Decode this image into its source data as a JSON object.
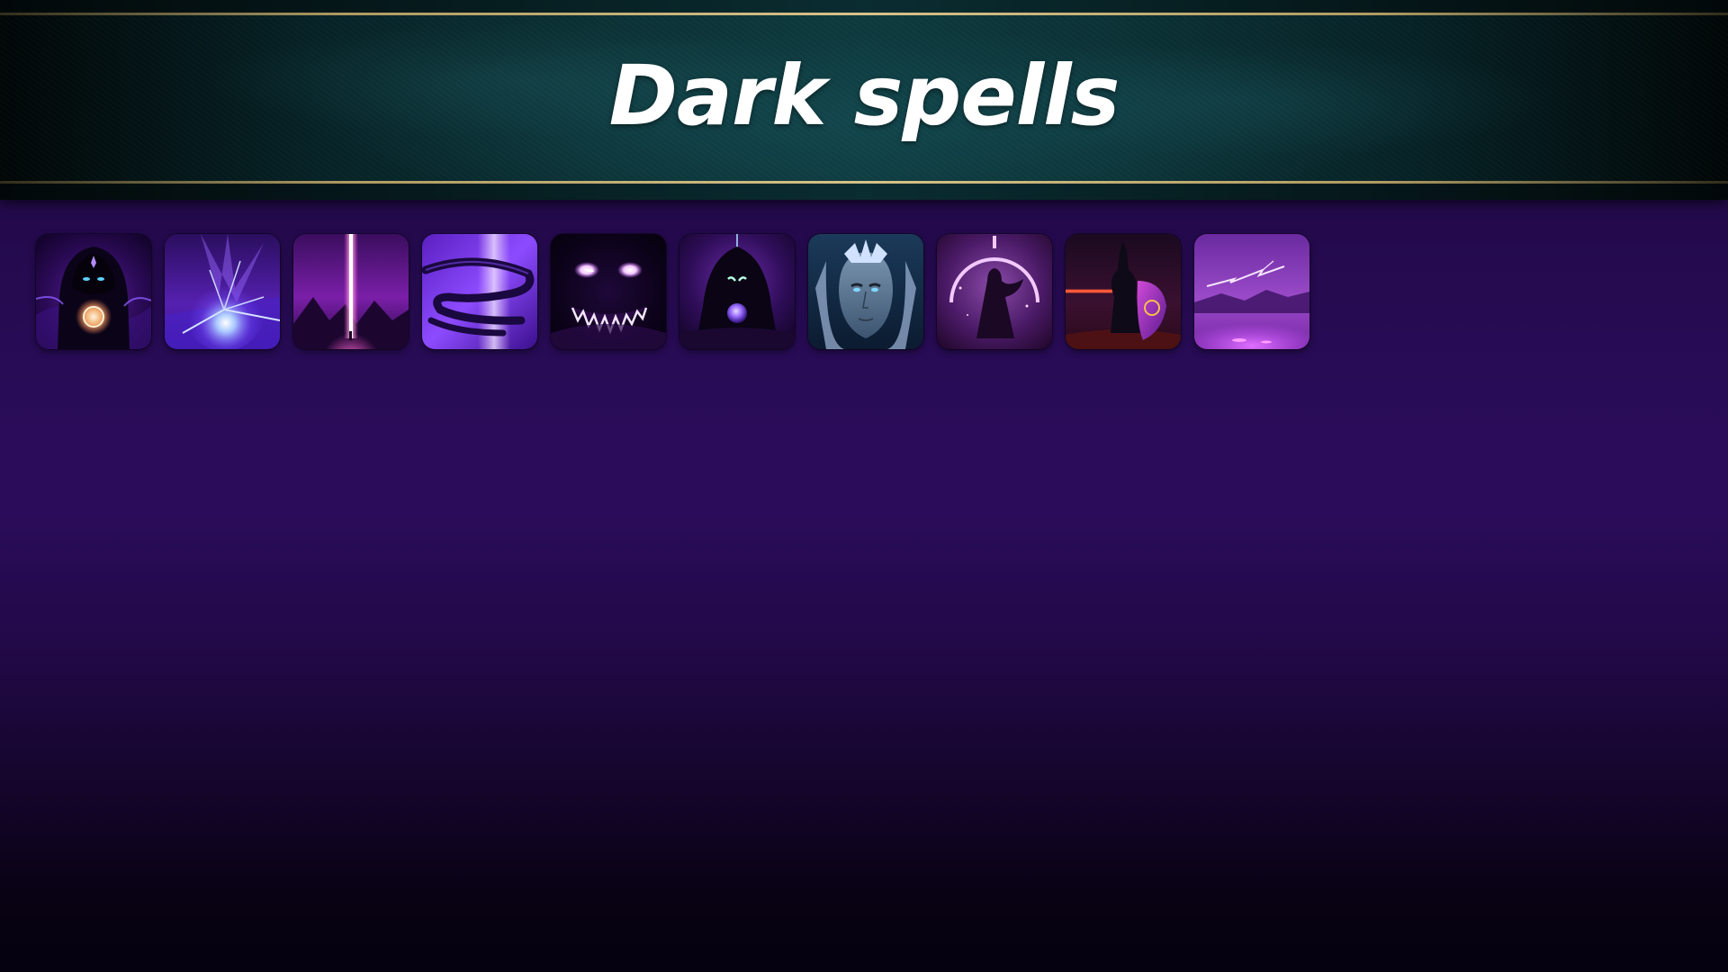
{
  "header": {
    "title": "Dark spells"
  },
  "spells": [
    {
      "icon": "hooded-sorcerer-with-glowing-orb-icon"
    },
    {
      "icon": "arcane-crystal-blast-icon"
    },
    {
      "icon": "purple-light-beam-icon"
    },
    {
      "icon": "shadow-serpent-swirl-icon"
    },
    {
      "icon": "grinning-shadow-demon-icon"
    },
    {
      "icon": "hooded-figure-with-orb-icon"
    },
    {
      "icon": "glowing-eyed-warrior-portrait-icon"
    },
    {
      "icon": "cloaked-figure-in-arch-icon"
    },
    {
      "icon": "dark-knight-with-shield-icon"
    },
    {
      "icon": "lightning-over-purple-lake-icon"
    }
  ],
  "colors": {
    "background_top": "#1d0840",
    "background_mid": "#2b0c5b",
    "background_bottom": "#050110",
    "banner": "#0b3236",
    "gold_trim": "#d7c28a",
    "title_text": "#ffffff"
  }
}
